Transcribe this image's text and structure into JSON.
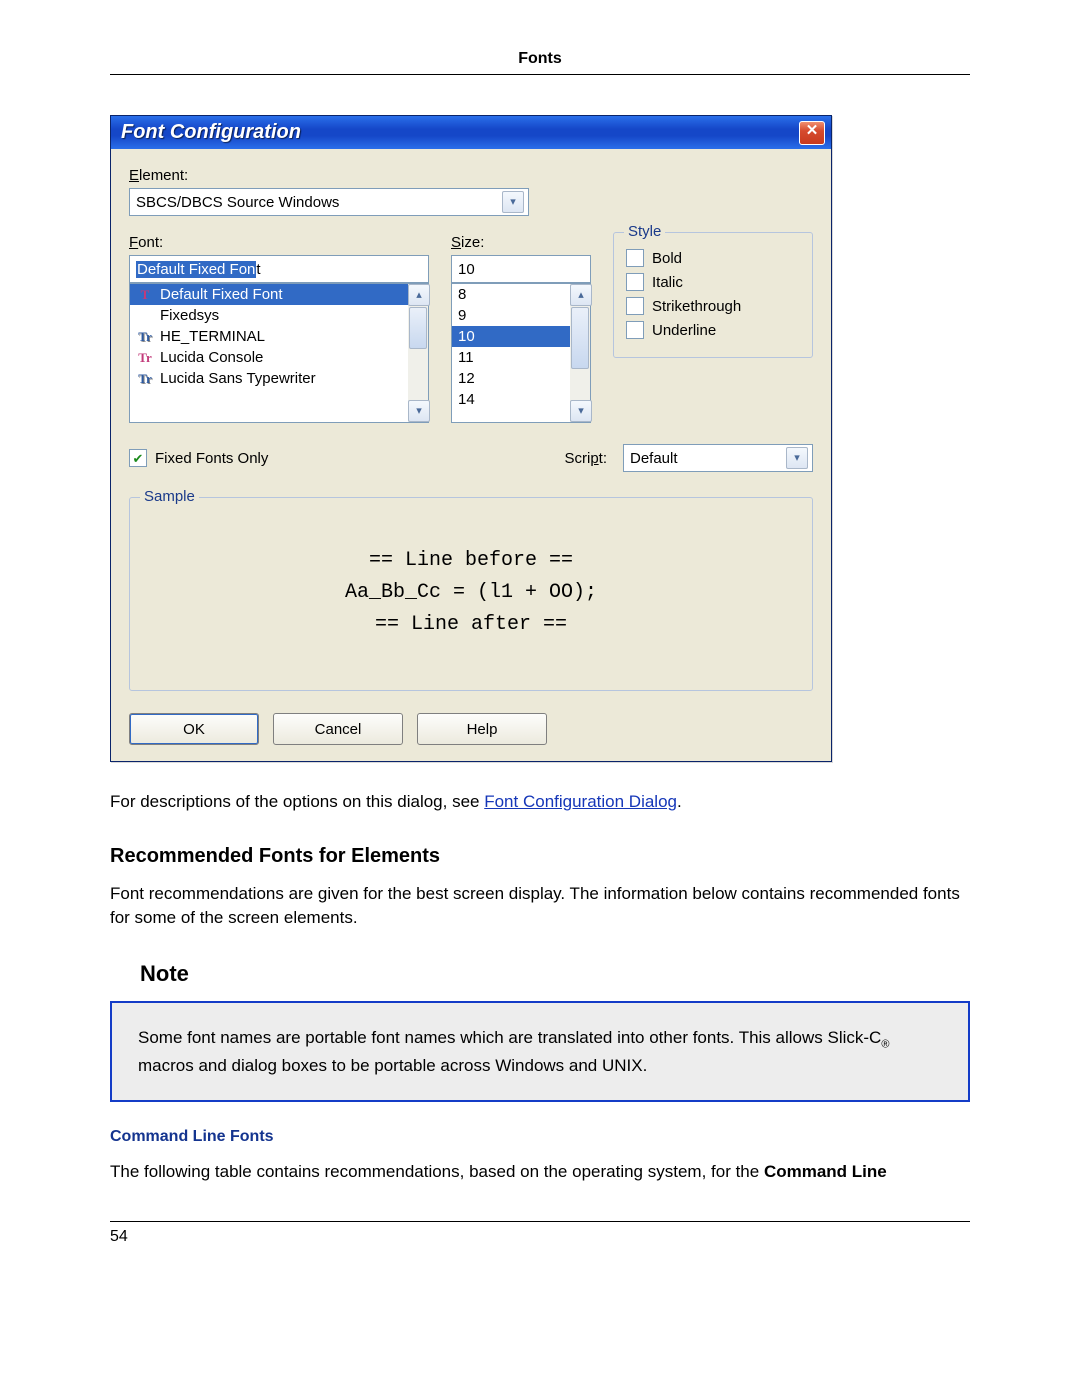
{
  "page": {
    "header": "Fonts",
    "number": "54"
  },
  "dialog": {
    "title": "Font Configuration",
    "labels": {
      "element": "Element:",
      "font": "Font:",
      "size": "Size:",
      "script": "Script:"
    },
    "element_value": "SBCS/DBCS Source Windows",
    "font_value": "Default Fixed Font",
    "font_value_hl": "Default Fixed Fon",
    "font_value_tail": "t",
    "font_list": [
      "Default Fixed Font",
      "Fixedsys",
      "HE_TERMINAL",
      "Lucida Console",
      "Lucida Sans Typewriter"
    ],
    "font_selected_index": 0,
    "size_value": "10",
    "size_list": [
      "8",
      "9",
      "10",
      "11",
      "12",
      "14"
    ],
    "size_selected_index": 2,
    "style": {
      "legend": "Style",
      "bold": "Bold",
      "italic": "Italic",
      "strike": "Strikethrough",
      "underline": "Underline"
    },
    "fixed_only": "Fixed Fonts Only",
    "fixed_only_checked": true,
    "script_value": "Default",
    "sample": {
      "legend": "Sample",
      "line1": "== Line before ==",
      "line2": "Aa_Bb_Cc = (l1 + OO);",
      "line3": "== Line after =="
    },
    "buttons": {
      "ok": "OK",
      "cancel": "Cancel",
      "help": "Help"
    }
  },
  "doc": {
    "para1_a": "For descriptions of the options on this dialog, see ",
    "para1_link": "Font Configuration Dialog",
    "para1_b": ".",
    "h2": "Recommended Fonts for Elements",
    "para2": "Font recommendations are given for the best screen display. The information below contains recommended fonts for some of the screen elements.",
    "note_h": "Note",
    "note_a": "Some font names are portable font names which are translated into other fonts. This allows Slick-C",
    "note_reg": "®",
    "note_b": " macros and dialog boxes to be portable across Windows and UNIX.",
    "h4": "Command Line Fonts",
    "para3_a": "The following table contains recommendations, based on the operating system, for the ",
    "para3_b": "Command Line"
  }
}
